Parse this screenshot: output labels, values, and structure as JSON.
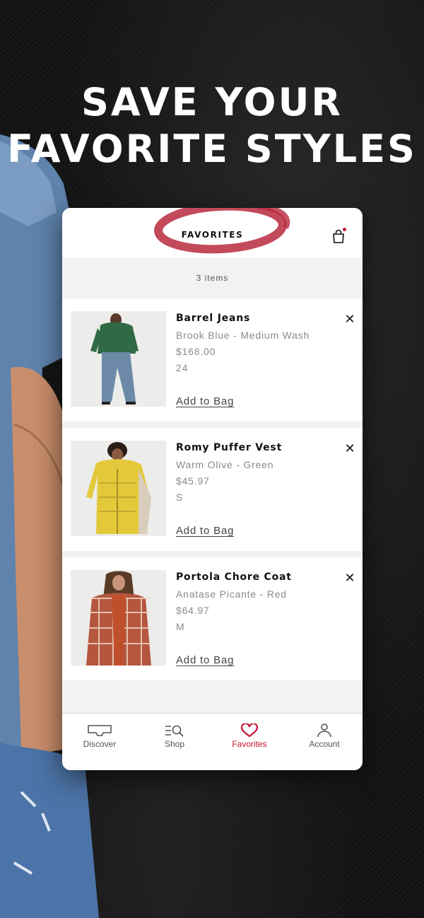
{
  "headline": {
    "line1": "SAVE YOUR",
    "line2": "FAVORITE STYLES"
  },
  "header": {
    "title": "FAVORITES",
    "bag_icon": "shopping-bag-icon",
    "bag_has_items": true
  },
  "item_count": "3 items",
  "items": [
    {
      "name": "Barrel Jeans",
      "color": "Brook Blue - Medium Wash",
      "price": "$168.00",
      "size": "24",
      "action": "Add to Bag",
      "remove_icon": "close-icon"
    },
    {
      "name": "Romy Puffer Vest",
      "color": "Warm Olive - Green",
      "price": "$45.97",
      "size": "S",
      "action": "Add to Bag",
      "remove_icon": "close-icon"
    },
    {
      "name": "Portola Chore Coat",
      "color": "Anatase Picante - Red",
      "price": "$64.97",
      "size": "M",
      "action": "Add to Bag",
      "remove_icon": "close-icon"
    }
  ],
  "tabs": [
    {
      "label": "Discover",
      "icon": "discover-icon",
      "active": false
    },
    {
      "label": "Shop",
      "icon": "search-list-icon",
      "active": false
    },
    {
      "label": "Favorites",
      "icon": "heart-icon",
      "active": true
    },
    {
      "label": "Account",
      "icon": "person-icon",
      "active": false
    }
  ],
  "colors": {
    "accent": "#c41230",
    "background": "#141414",
    "panel": "#f2f2f2"
  }
}
